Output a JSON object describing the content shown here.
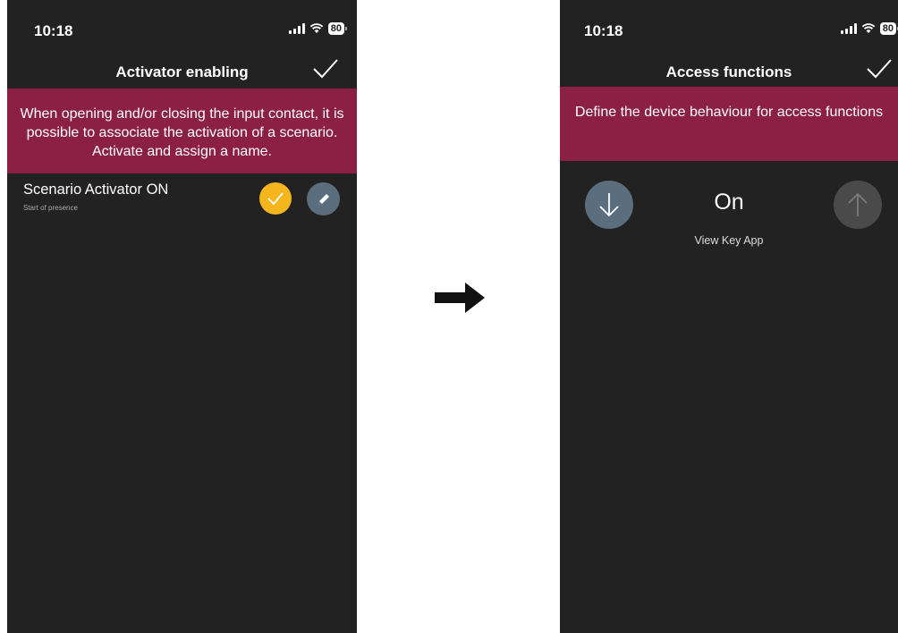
{
  "colors": {
    "background": "#222222",
    "banner": "#8b2044",
    "active_toggle": "#f5b51d",
    "button_slate": "#5a6e7d",
    "button_disabled": "#4a4a4a",
    "divider_arrow": "#111111"
  },
  "left_screen": {
    "status": {
      "time": "10:18",
      "battery": "80"
    },
    "title": "Activator enabling",
    "confirm_icon": "checkmark-icon",
    "banner_text": "When opening and/or closing the input contact, it is possible to associate the activation of a scenario. Activate and assign a name.",
    "scenario": {
      "title": "Scenario Activator ON",
      "subtitle": "Start of presence",
      "enabled": true,
      "toggle_icon": "checkmark-icon",
      "edit_icon": "pencil-icon"
    }
  },
  "divider_icon": "right-arrow-icon",
  "right_screen": {
    "status": {
      "time": "10:18",
      "battery": "80"
    },
    "title": "Access functions",
    "confirm_icon": "checkmark-icon",
    "banner_text": "Define the device behaviour for access functions",
    "state": "On",
    "caption": "View Key App",
    "down_icon": "arrow-down-icon",
    "up_icon": "arrow-up-icon"
  }
}
